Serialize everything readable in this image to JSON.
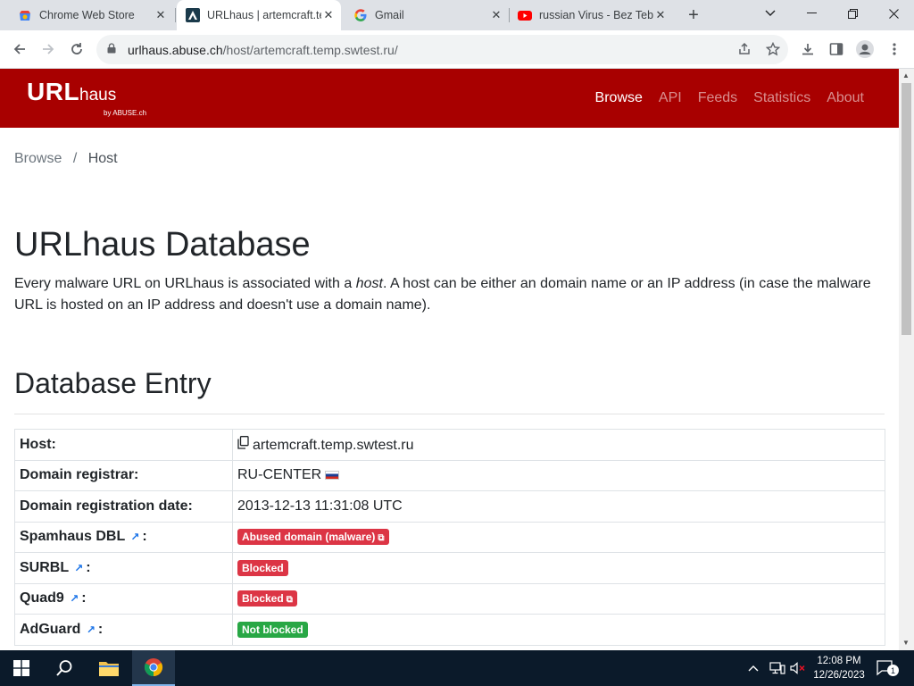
{
  "browser": {
    "tabs": [
      {
        "title": "Chrome Web Store",
        "icon": "chrome-webstore-icon",
        "active": false
      },
      {
        "title": "URLhaus | artemcraft.temp",
        "icon": "urlhaus-icon",
        "active": true
      },
      {
        "title": "Gmail",
        "icon": "google-icon",
        "active": false
      },
      {
        "title": "russian Virus - Bez Teb",
        "icon": "youtube-icon",
        "active": false
      }
    ],
    "url_host": "urlhaus.abuse.ch",
    "url_path": "/host/artemcraft.temp.swtest.ru/"
  },
  "site": {
    "logo_main": "URL",
    "logo_suffix": "haus",
    "logo_by": "by ABUSE.ch",
    "nav": [
      "Browse",
      "API",
      "Feeds",
      "Statistics",
      "About"
    ],
    "active_nav": "Browse",
    "accent_color": "#a80000"
  },
  "breadcrumb": {
    "parent": "Browse",
    "sep": "/",
    "current": "Host"
  },
  "heading": "URLhaus Database",
  "intro": {
    "part1": "Every malware URL on URLhaus is associated with a ",
    "em": "host",
    "part2": ". A host can be either an domain name or an IP address (in case the malware URL is hosted on an IP address and doesn't use a domain name)."
  },
  "section_title": "Database Entry",
  "entry": {
    "host_label": "Host:",
    "host_value": "artemcraft.temp.swtest.ru",
    "registrar_label": "Domain registrar:",
    "registrar_value": "RU-CENTER",
    "regdate_label": "Domain registration date:",
    "regdate_value": "2013-12-13 11:31:08 UTC",
    "spamhaus_label": "Spamhaus DBL",
    "spamhaus_value": "Abused domain (malware)",
    "surbl_label": "SURBL",
    "surbl_value": "Blocked",
    "quad9_label": "Quad9",
    "quad9_value": "Blocked",
    "adguard_label": "AdGuard",
    "adguard_value": "Not blocked"
  },
  "taskbar": {
    "time": "12:08 PM",
    "date": "12/26/2023",
    "notifications": "1"
  }
}
